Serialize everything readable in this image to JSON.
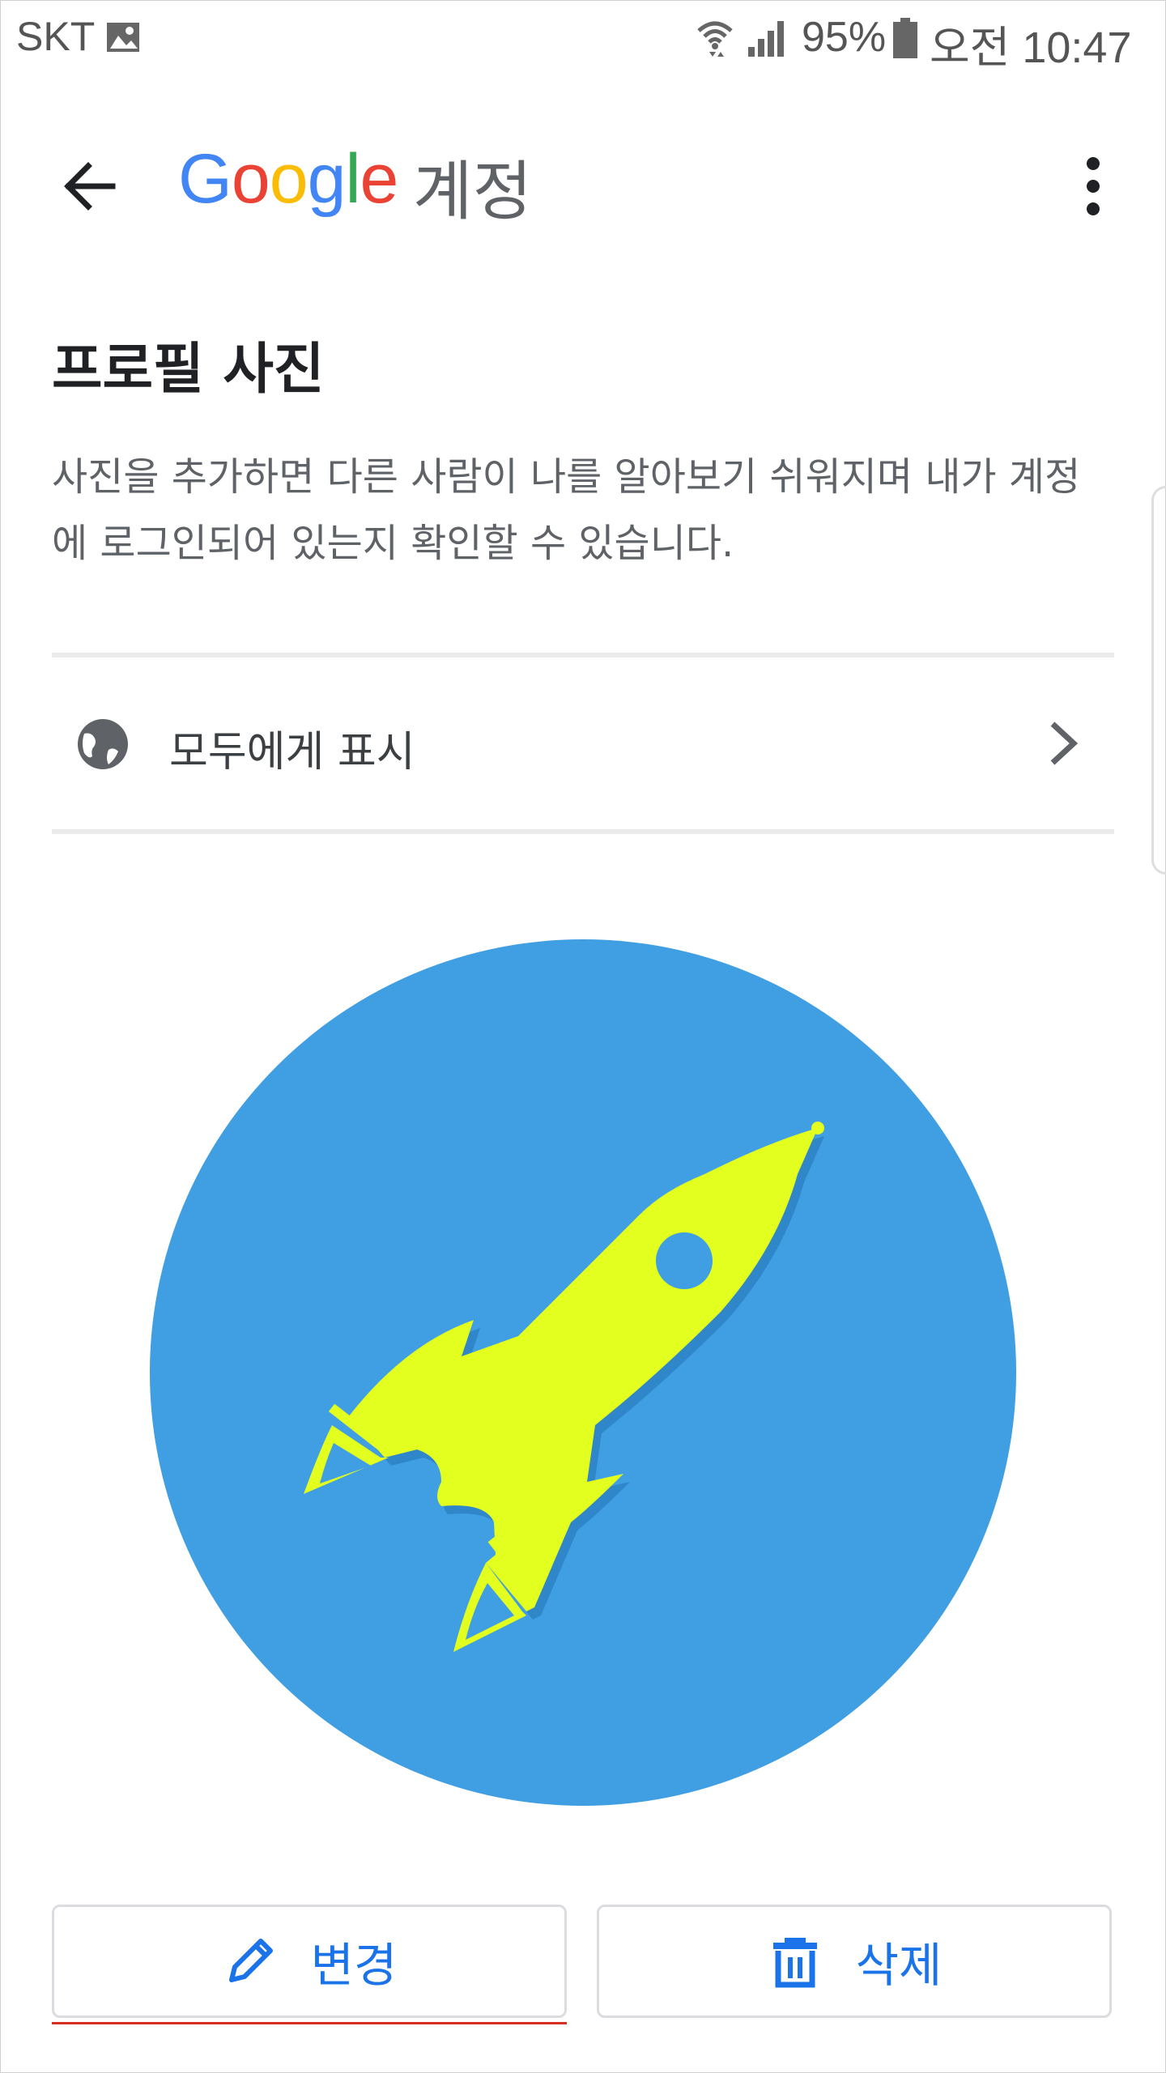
{
  "status_bar": {
    "carrier": "SKT",
    "battery": "95%",
    "time": "오전 10:47",
    "icons": [
      "gallery-icon",
      "wifi-icon",
      "signal-icon",
      "battery-icon"
    ]
  },
  "app_bar": {
    "logo_letters": [
      "G",
      "o",
      "o",
      "g",
      "l",
      "e"
    ],
    "logo_colors": [
      "#4285F4",
      "#EA4335",
      "#FBBC05",
      "#4285F4",
      "#34A853",
      "#EA4335"
    ],
    "title": "계정",
    "icons": [
      "back-arrow-icon",
      "more-vert-icon"
    ]
  },
  "profile": {
    "title": "프로필 사진",
    "description": "사진을 추가하면 다른 사람이 나를 알아보기 쉬워지며 내가 계정에 로그인되어 있는지 확인할 수 있습니다.",
    "visibility_label": "모두에게 표시",
    "visibility_icon": "globe-icon",
    "avatar_bg": "#409ee2",
    "rocket_color": "#e2ff1f"
  },
  "actions": {
    "change_label": "변경",
    "delete_label": "삭제",
    "accent": "#1a73e8"
  }
}
